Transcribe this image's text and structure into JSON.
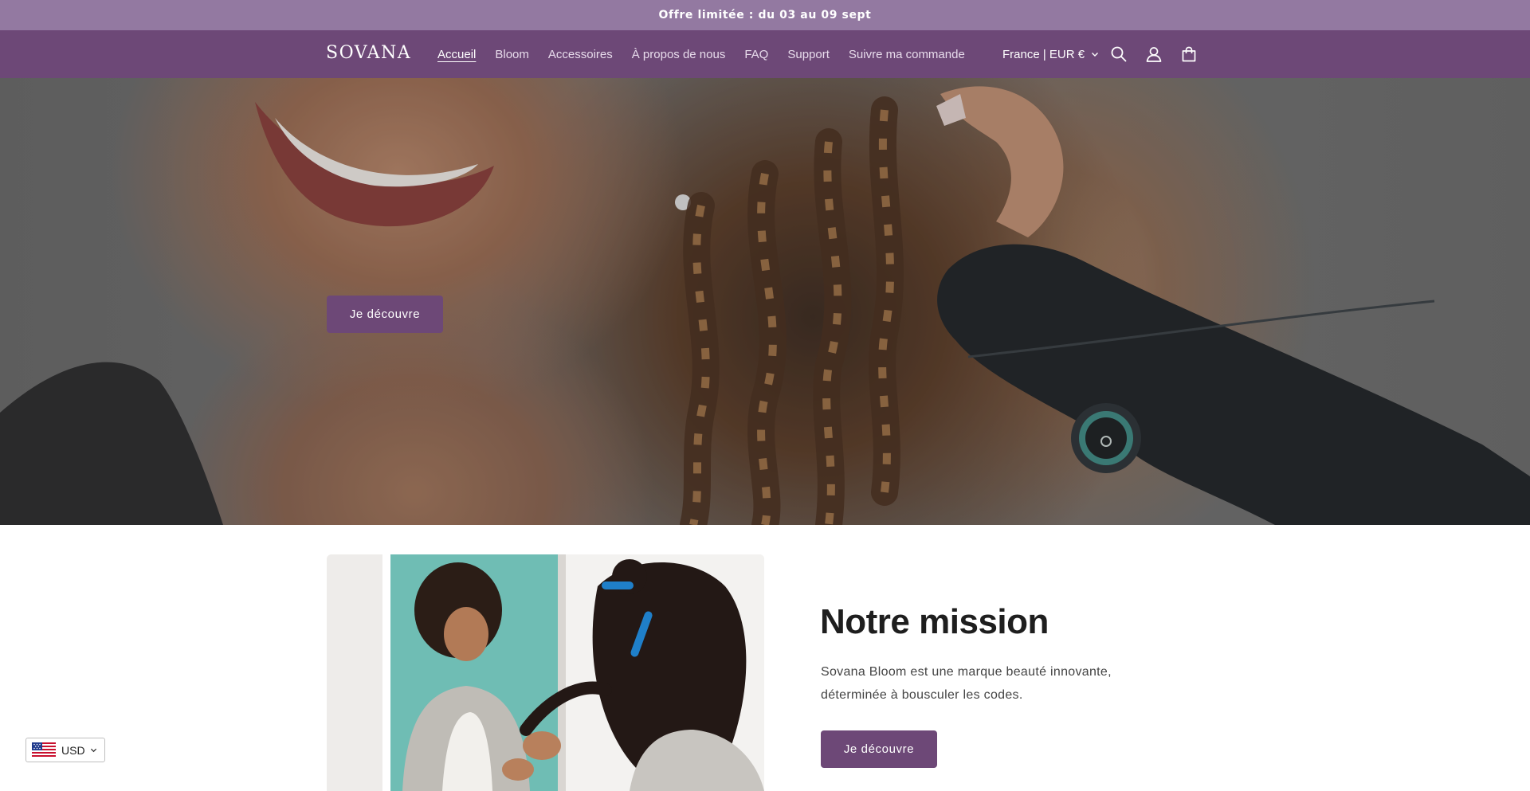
{
  "announcement": {
    "text": "Offre limitée : du 03 au 09 sept"
  },
  "header": {
    "logo": "SOVANA",
    "nav": [
      {
        "label": "Accueil",
        "active": true
      },
      {
        "label": "Bloom",
        "active": false
      },
      {
        "label": "Accessoires",
        "active": false
      },
      {
        "label": "À propos de nous",
        "active": false
      },
      {
        "label": "FAQ",
        "active": false
      },
      {
        "label": "Support",
        "active": false
      },
      {
        "label": "Suivre ma commande",
        "active": false
      }
    ],
    "country_selector": "France | EUR €",
    "icons": [
      "search-icon",
      "account-icon",
      "cart-icon"
    ]
  },
  "hero": {
    "button_label": "Je découvre"
  },
  "mission": {
    "title": "Notre mission",
    "text_line1": "Sovana Bloom est une marque beauté innovante,",
    "text_line2": "déterminée à bousculer les codes.",
    "button_label": "Je découvre"
  },
  "currency": {
    "code": "USD",
    "flag_icon": "us-flag-icon"
  },
  "colors": {
    "announcement_bg": "#9379a1",
    "header_bg": "#6d4877",
    "button_bg": "#6d4877"
  }
}
